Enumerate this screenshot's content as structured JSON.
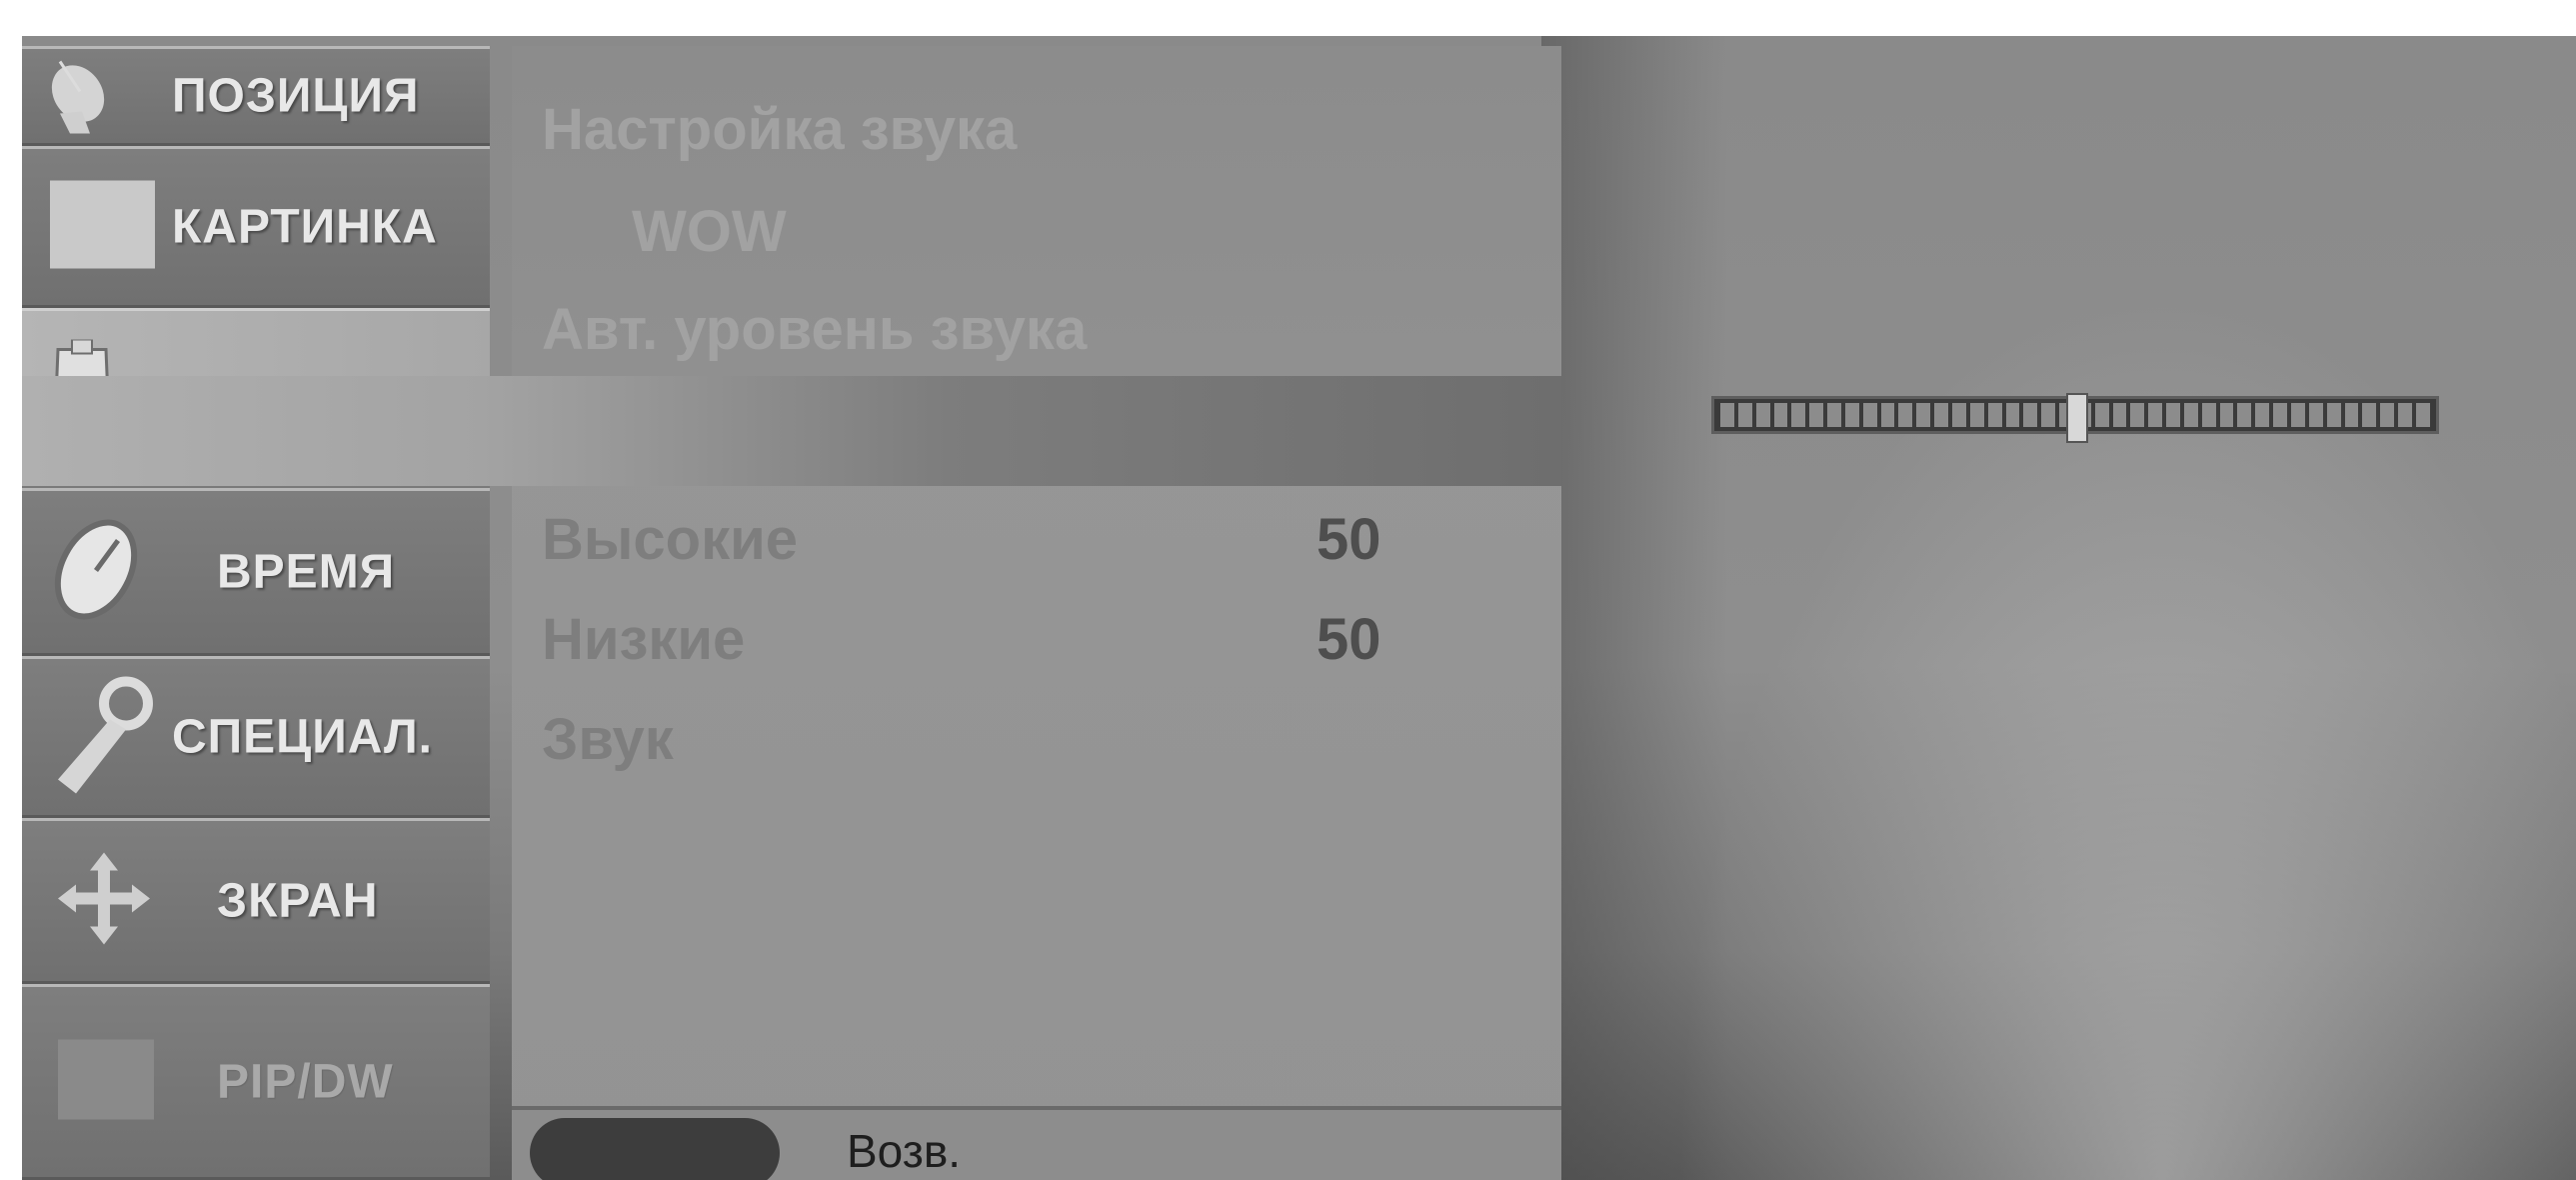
{
  "sidebar": {
    "items": [
      {
        "label": "ПОЗИЦИЯ",
        "icon": "satellite-dish-icon"
      },
      {
        "label": "КАРТИНКА",
        "icon": "picture-icon"
      },
      {
        "label": "",
        "icon": "speaker-icon",
        "active": true
      },
      {
        "label": "ВРЕМЯ",
        "icon": "clock-icon"
      },
      {
        "label": "СПЕЦИАЛ.",
        "icon": "key-icon"
      },
      {
        "label": "ЗКРАН",
        "icon": "move-arrows-icon"
      },
      {
        "label": "PIP/DW",
        "icon": "pip-icon"
      }
    ]
  },
  "menu": {
    "items": [
      {
        "label": "Настройка звука"
      },
      {
        "label": "WOW"
      },
      {
        "label": "Авт. уровень звука"
      },
      {
        "label": ""
      },
      {
        "label": "Высокие",
        "value": "50"
      },
      {
        "label": "Низкие",
        "value": "50"
      },
      {
        "label": "Звук"
      }
    ]
  },
  "footer": {
    "back_label": "Возв."
  },
  "balance": {
    "level": 0.5
  },
  "colors": {
    "text_light": "#e8e8e8",
    "value_dark": "#4e4e4e"
  }
}
